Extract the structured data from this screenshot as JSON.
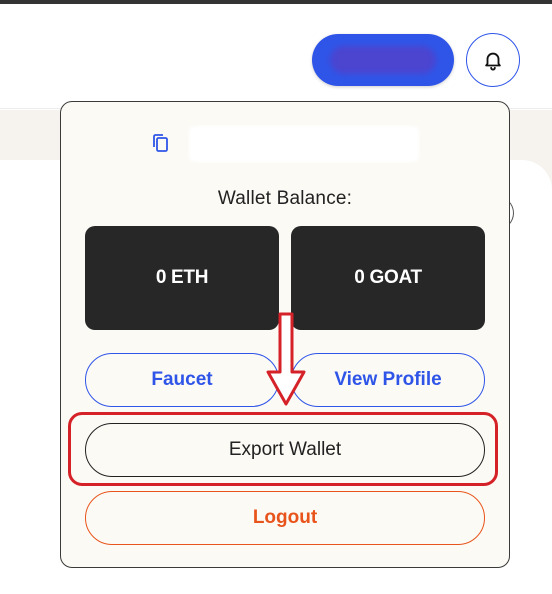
{
  "header": {
    "connect_button_label": "",
    "notifications_icon": "bell-icon"
  },
  "dropdown": {
    "copy_icon": "copy-icon",
    "address": "",
    "balance_label": "Wallet Balance:",
    "balances": {
      "eth": "0 ETH",
      "goat": "0 GOAT"
    },
    "faucet_label": "Faucet",
    "view_profile_label": "View Profile",
    "export_wallet_label": "Export Wallet",
    "logout_label": "Logout"
  },
  "colors": {
    "accent_blue": "#2f55e8",
    "logout_orange": "#e8541b",
    "card_dark": "#272727",
    "annotation_red": "#d52228",
    "panel_bg": "#fcfaf5"
  }
}
